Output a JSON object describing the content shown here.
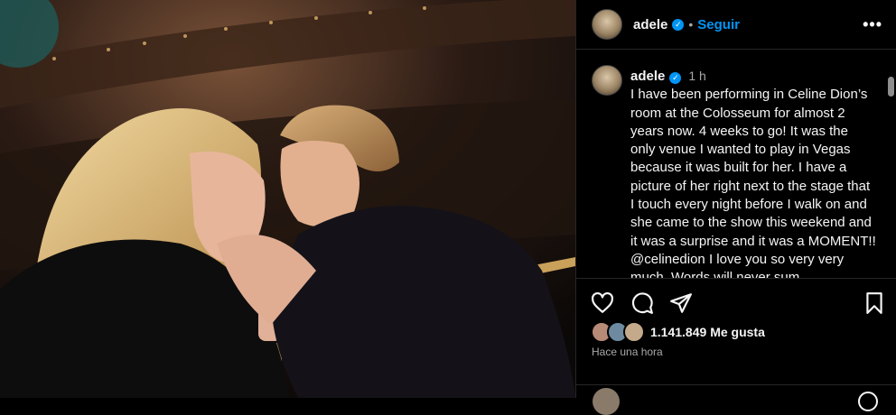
{
  "post": {
    "username": "adele",
    "follow_label": "Seguir",
    "separator": "•",
    "more_label": "•••",
    "verified_mark": "✓",
    "caption": {
      "username": "adele",
      "time": "1 h",
      "text": "I have been performing in Celine Dion’s room at the Colosseum for almost 2 years now. 4 weeks to go! It was the only venue I wanted to play in Vegas because it was built for her. I have a picture of her right next to the stage that I touch every night before I walk on and she came to the show this weekend and it was a surprise and it was a MOMENT!! @celinedion I love you so very very much. Words will never sum"
    },
    "actions": {
      "like_icon": "heart-icon",
      "comment_icon": "comment-icon",
      "share_icon": "send-icon",
      "save_icon": "bookmark-icon"
    },
    "likes_count": "1.141.849",
    "likes_label": "Me gusta",
    "posted_ago": "Hace una hora"
  },
  "colors": {
    "accent": "#0095f6",
    "text": "#f5f5f5",
    "muted": "#a8a8a8",
    "border": "#262626"
  }
}
